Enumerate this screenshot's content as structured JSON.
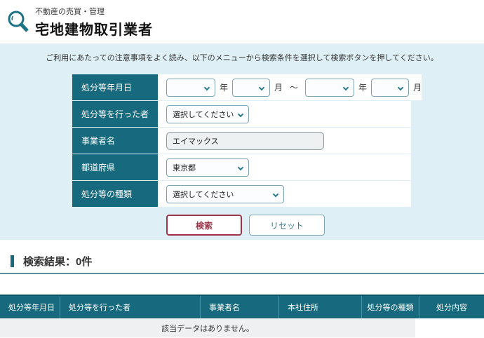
{
  "header": {
    "breadcrumb": "不動産の売買・管理",
    "title": "宅地建物取引業者"
  },
  "search_panel": {
    "instruction": "ご利用にあたっての注意事項をよく読み、以下のメニューから検索条件を選択して検索ボタンを押してください。",
    "fields": {
      "date": {
        "label": "処分等年月日",
        "from_year": "",
        "from_month": "",
        "to_year": "",
        "to_month": "",
        "year_suffix": "年",
        "month_suffix": "月",
        "separator": "～"
      },
      "authority": {
        "label": "処分等を行った者",
        "value": "選択してください"
      },
      "business_name": {
        "label": "事業者名",
        "value": "エイマックス"
      },
      "prefecture": {
        "label": "都道府県",
        "value": "東京都"
      },
      "disposition_type": {
        "label": "処分等の種類",
        "value": "選択してください"
      }
    },
    "buttons": {
      "search": "検索",
      "reset": "リセット"
    }
  },
  "results": {
    "heading": "検索結果：0件",
    "table": {
      "columns": [
        "処分等年月日",
        "処分等を行った者",
        "事業者名",
        "本社住所",
        "処分等の種類",
        "処分内容"
      ],
      "empty_message": "該当データはありません。"
    }
  },
  "colors": {
    "teal": "#176a7d",
    "panel_bg": "#def0f6",
    "accent_red": "#9d3448"
  }
}
